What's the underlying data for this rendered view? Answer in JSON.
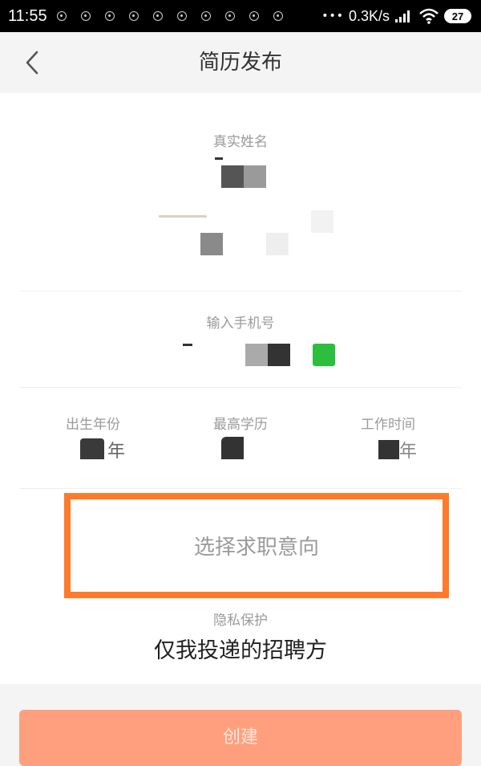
{
  "status_bar": {
    "time": "11:55",
    "more": "•••",
    "network_speed": "0.3K/s",
    "battery": "27",
    "icons": [
      "notification-icon",
      "signal-icon",
      "wifi-icon",
      "battery-icon"
    ]
  },
  "header": {
    "title": "简历发布",
    "back_icon": "chevron-left-icon"
  },
  "form": {
    "name_label": "真实姓名",
    "phone_label": "输入手机号",
    "birth_label": "出生年份",
    "education_label": "最高学历",
    "work_time_label": "工作时间",
    "birth_suffix": "年",
    "work_time_suffix": "年",
    "intent_placeholder": "选择求职意向",
    "privacy_label": "隐私保护",
    "privacy_value": "仅我投递的招聘方"
  },
  "actions": {
    "create_label": "创建"
  },
  "colors": {
    "accent_border": "#ff7a2b",
    "create_button": "#ff9f7e",
    "page_bg": "#f4f4f4"
  }
}
